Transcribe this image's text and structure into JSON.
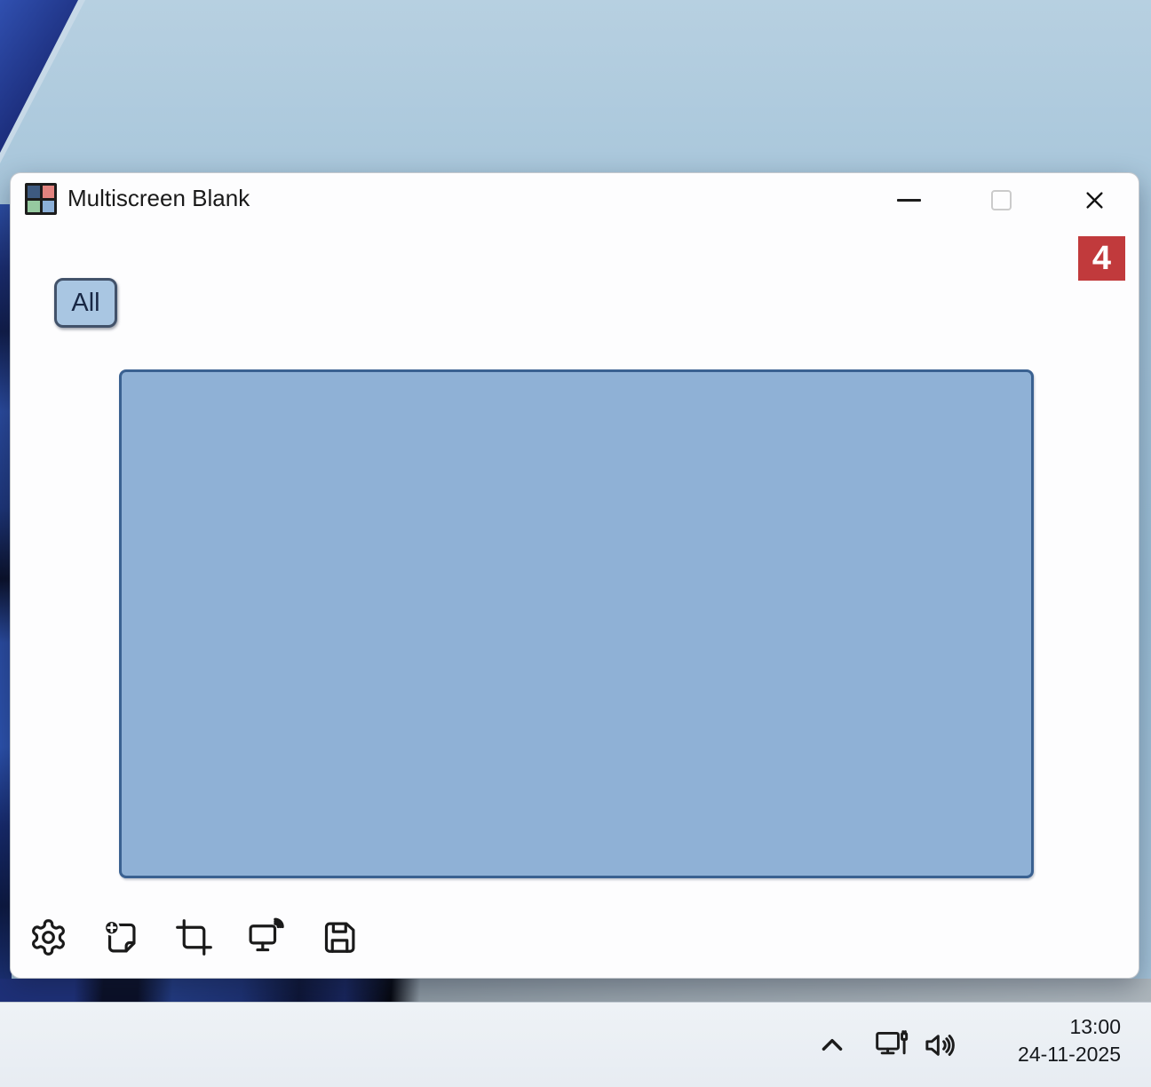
{
  "desktop": {
    "wallpaper_base_color": "#9fc0d8",
    "wallpaper_accent_color": "#1d2f7e"
  },
  "window": {
    "title": "Multiscreen Blank",
    "app_icon": {
      "name": "multiscreen-app-icon",
      "colors": [
        "#3e5a80",
        "#e2837f",
        "#96c9a0",
        "#8cb0d8"
      ]
    },
    "controls": {
      "minimize": "minimize",
      "maximize": "maximize",
      "close": "close"
    },
    "annotation_badge": {
      "value": "4",
      "color": "#c13a3c"
    },
    "all_button_label": "All",
    "preview": {
      "fill": "#8fb1d6",
      "border": "#3a6191"
    },
    "toolbar_items": [
      {
        "name": "settings",
        "icon": "gear-icon"
      },
      {
        "name": "add-note",
        "icon": "note-add-icon"
      },
      {
        "name": "crop",
        "icon": "crop-icon"
      },
      {
        "name": "cast-screen",
        "icon": "monitor-cast-icon"
      },
      {
        "name": "save",
        "icon": "save-icon"
      }
    ]
  },
  "taskbar": {
    "tray_icons": [
      "chevron-up-icon",
      "network-icon",
      "volume-icon"
    ],
    "clock": {
      "time": "13:00",
      "date": "24-11-2025"
    }
  }
}
